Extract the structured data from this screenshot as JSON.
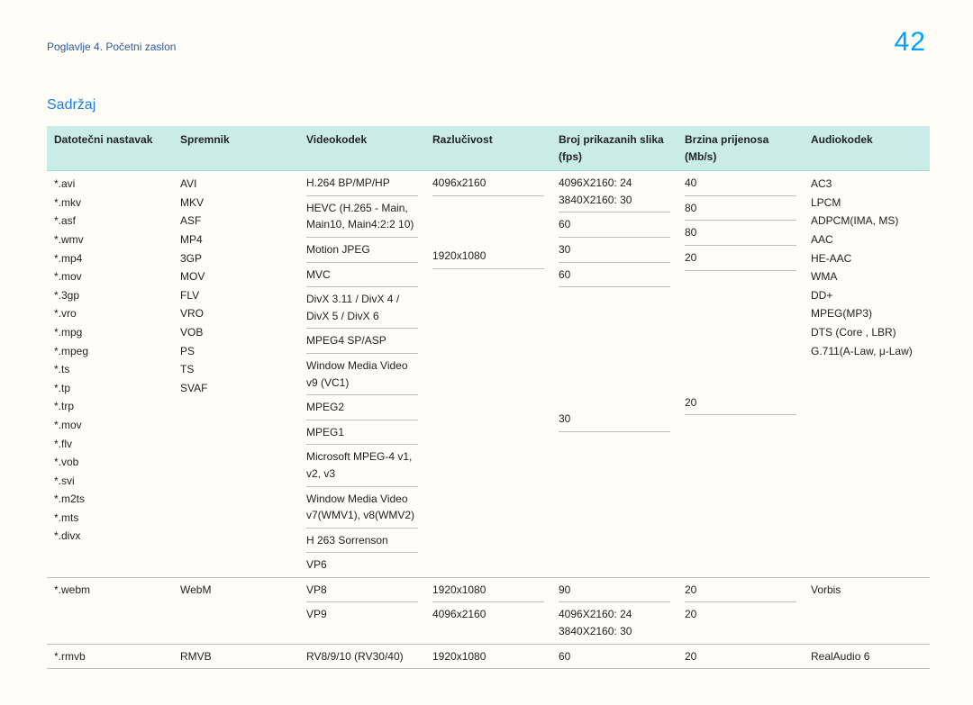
{
  "header": {
    "breadcrumb": "Poglavlje 4. Početni zaslon",
    "page_number": "42"
  },
  "section_title": "Sadržaj",
  "columns": {
    "c1": "Datotečni nastavak",
    "c2": "Spremnik",
    "c3": "Videokodek",
    "c4": "Razlučivost",
    "c5": "Broj prikazanih slika (fps)",
    "c6": "Brzina prijenosa (Mb/s)",
    "c7": "Audiokodek"
  },
  "group1": {
    "ext": [
      "*.avi",
      "*.mkv",
      "*.asf",
      "*.wmv",
      "*.mp4",
      "*.mov",
      "*.3gp",
      "*.vro",
      "*.mpg",
      "*.mpeg",
      "*.ts",
      "*.tp",
      "*.trp",
      "*.mov",
      "*.flv",
      "*.vob",
      "*.svi",
      "*.m2ts",
      "*.mts",
      "*.divx"
    ],
    "container": [
      "AVI",
      "MKV",
      "ASF",
      "MP4",
      "3GP",
      "MOV",
      "FLV",
      "VRO",
      "VOB",
      "PS",
      "TS",
      "SVAF"
    ],
    "audio": [
      "AC3",
      "LPCM",
      "ADPCM(IMA, MS)",
      "AAC",
      "HE-AAC",
      "WMA",
      "DD+",
      "MPEG(MP3)",
      "DTS (Core , LBR)",
      "G.711(A-Law, μ-Law)"
    ],
    "rows": [
      {
        "codec": "H.264 BP/MP/HP",
        "res": "4096x2160",
        "fps": "4096X2160: 24\n3840X2160: 30",
        "rate": "40"
      },
      {
        "codec": "HEVC (H.265 - Main, Main10, Main4:2:2 10)",
        "res": "",
        "fps": "60",
        "rate": "80"
      },
      {
        "codec": "Motion JPEG",
        "res": "",
        "fps": "30",
        "rate": "80"
      },
      {
        "codec": "MVC",
        "res": "1920x1080",
        "fps": "60",
        "rate": "20"
      },
      {
        "codec": "DivX 3.11 / DivX 4 / DivX 5 / DivX 6",
        "res": "",
        "fps": "",
        "rate": ""
      },
      {
        "codec": "MPEG4 SP/ASP",
        "res": "",
        "fps": "",
        "rate": ""
      },
      {
        "codec": "Window Media Video v9 (VC1)",
        "res": "",
        "fps": "",
        "rate": ""
      },
      {
        "codec": "MPEG2",
        "res": "",
        "fps": "",
        "rate": ""
      },
      {
        "codec": "MPEG1",
        "res": "",
        "fps": "",
        "rate": ""
      },
      {
        "codec": "Microsoft MPEG-4 v1, v2, v3",
        "res": "",
        "fps": "30",
        "rate": "20"
      },
      {
        "codec": "Window Media Video v7(WMV1), v8(WMV2)",
        "res": "",
        "fps": "",
        "rate": ""
      },
      {
        "codec": "H 263 Sorrenson",
        "res": "",
        "fps": "",
        "rate": ""
      },
      {
        "codec": "VP6",
        "res": "",
        "fps": "",
        "rate": ""
      }
    ]
  },
  "group2": {
    "ext": "*.webm",
    "container": "WebM",
    "audio": "Vorbis",
    "rows": [
      {
        "codec": "VP8",
        "res": "1920x1080",
        "fps": "90",
        "rate": "20"
      },
      {
        "codec": "VP9",
        "res": "4096x2160",
        "fps": "4096X2160: 24\n3840X2160: 30",
        "rate": "20"
      }
    ]
  },
  "group3": {
    "ext": "*.rmvb",
    "container": "RMVB",
    "codec": "RV8/9/10 (RV30/40)",
    "res": "1920x1080",
    "fps": "60",
    "rate": "20",
    "audio": "RealAudio 6"
  }
}
